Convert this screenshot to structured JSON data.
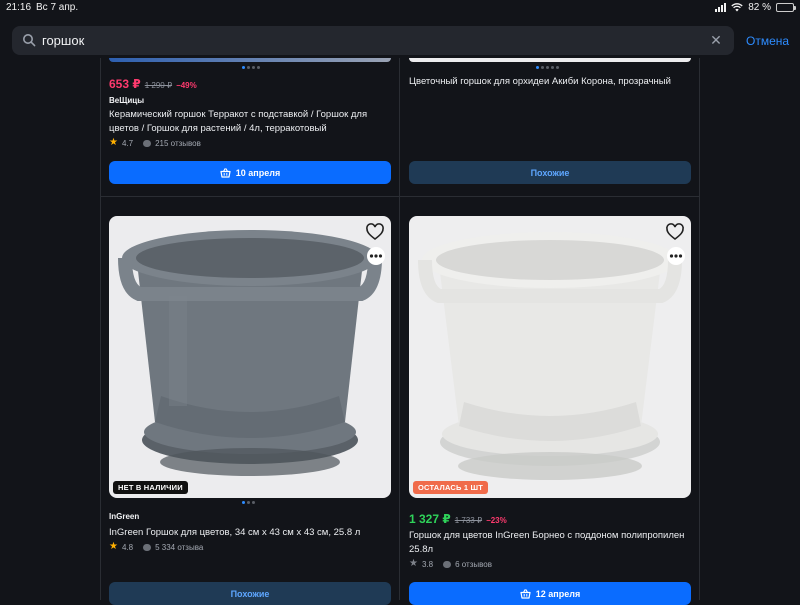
{
  "status": {
    "time": "21:16",
    "date": "Вс 7 апр.",
    "battery": "82 %",
    "battery_level": 0.82
  },
  "search": {
    "value": "горшок",
    "cancel_label": "Отмена"
  },
  "products": [
    {
      "price": "653 ₽",
      "old_price": "1 290 ₽",
      "discount": "−49%",
      "brand": "BeЩицы",
      "title": "Керамический горшок Терракот с подставкой / Горшок для цветов / Горшок для растений / 4л, терракотовый",
      "rating": "4.7",
      "reviews": "215 отзывов",
      "button_label": "10 апреля",
      "button_icon": "basket-icon"
    },
    {
      "title": "Цветочный горшок для орхидеи Акиби Корона, прозрачный",
      "button_label": "Похожие"
    },
    {
      "badge": "НЕТ В НАЛИЧИИ",
      "brand": "InGreen",
      "title": "InGreen Горшок для цветов, 34 см х 43 см х 43 см, 25.8 л",
      "rating": "4.8",
      "reviews": "5 334 отзыва",
      "button_label": "Похожие",
      "image_color": "#6f777f"
    },
    {
      "badge": "ОСТАЛАСЬ 1 ШТ",
      "price": "1 327 ₽",
      "old_price": "1 733 ₽",
      "discount": "−23%",
      "title": "Горшок для цветов InGreen Борнео с поддоном полипропилен 25.8л",
      "rating": "3.8",
      "reviews": "6 отзывов",
      "button_label": "12 апреля",
      "button_icon": "basket-icon",
      "image_color": "#e6e6e4"
    }
  ],
  "colors": {
    "accent": "#0a6cff",
    "pink_price": "#ff3a6e",
    "green_price": "#2fd35a",
    "background": "#121419"
  }
}
